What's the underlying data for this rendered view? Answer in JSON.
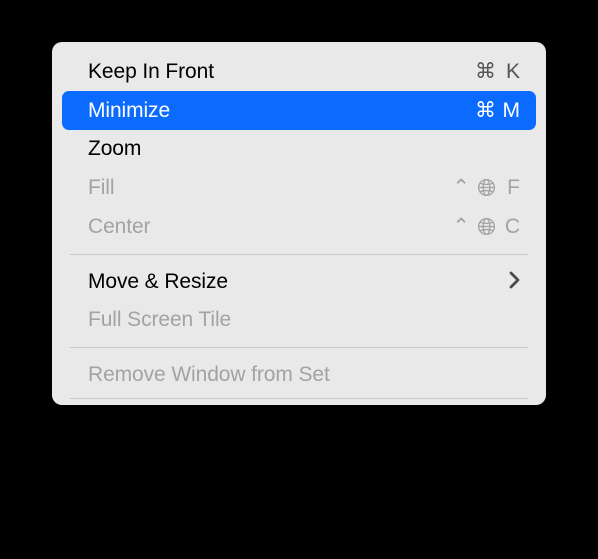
{
  "menu": {
    "items": [
      {
        "id": "keep-in-front",
        "label": "Keep In Front",
        "shortcut_cmd": "⌘",
        "shortcut_key": "K",
        "disabled": false,
        "highlighted": false
      },
      {
        "id": "minimize",
        "label": "Minimize",
        "shortcut_cmd": "⌘",
        "shortcut_key": "M",
        "disabled": false,
        "highlighted": true
      },
      {
        "id": "zoom",
        "label": "Zoom",
        "disabled": false,
        "highlighted": false
      },
      {
        "id": "fill",
        "label": "Fill",
        "shortcut_ctrl": "⌃",
        "shortcut_globe": true,
        "shortcut_key": "F",
        "disabled": true,
        "highlighted": false
      },
      {
        "id": "center",
        "label": "Center",
        "shortcut_ctrl": "⌃",
        "shortcut_globe": true,
        "shortcut_key": "C",
        "disabled": true,
        "highlighted": false
      },
      {
        "id": "move-resize",
        "label": "Move & Resize",
        "submenu": true,
        "disabled": false,
        "highlighted": false
      },
      {
        "id": "full-screen-tile",
        "label": "Full Screen Tile",
        "disabled": true,
        "highlighted": false
      },
      {
        "id": "remove-window-from-set",
        "label": "Remove Window from Set",
        "disabled": true,
        "highlighted": false
      }
    ],
    "colors": {
      "highlight": "#0b6bff",
      "background": "#e9e9e9",
      "text": "#000000",
      "disabled": "#a3a3a3"
    }
  }
}
